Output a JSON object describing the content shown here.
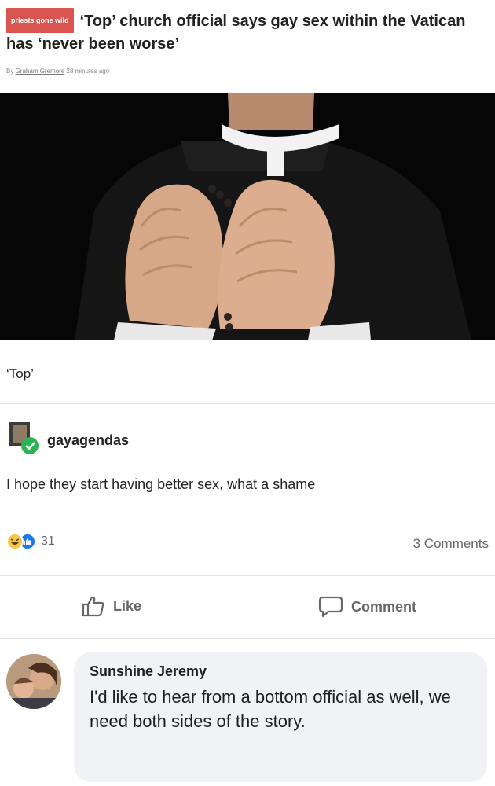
{
  "article": {
    "tag": "priests gone wild",
    "headline": "‘Top’ church official says gay sex within the Vatican has ‘never been worse’",
    "byline_prefix": "By",
    "author": "Graham Gremore",
    "time": "28 minutes ago",
    "caption": "‘Top’"
  },
  "post": {
    "username": "gayagendas",
    "text": "I hope they start having better sex, what a shame",
    "reaction_count": "31",
    "comments_count": "3 Comments",
    "like_label": "Like",
    "comment_label": "Comment"
  },
  "comment": {
    "author": "Sunshine Jeremy",
    "text": "I'd like to hear from a bottom official as well, we need both sides of the story."
  },
  "colors": {
    "tag_bg": "#d9534f",
    "like_blue": "#1877f2",
    "laugh_yellow": "#f7c643",
    "bubble_bg": "#f0f2f5",
    "muted_text": "#65676b"
  },
  "icons": [
    "like-reaction-icon",
    "laugh-reaction-icon",
    "thumbs-up-icon",
    "comment-bubble-icon"
  ]
}
